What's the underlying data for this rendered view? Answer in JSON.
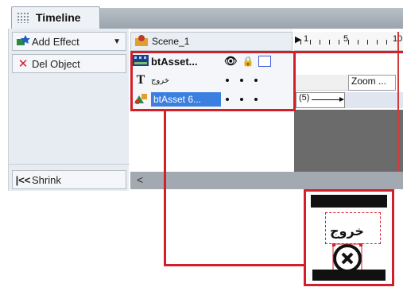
{
  "window": {
    "tab_title": "Timeline"
  },
  "left_panel": {
    "add_effect_label": "Add Effect",
    "del_object_label": "Del Object",
    "shrink_label": "Shrink"
  },
  "layers": {
    "scene_label": "Scene_1",
    "asset_group_label": "btAsset...",
    "text_layer_label": "خروج",
    "selected_layer_label": "btAsset 6..."
  },
  "timeline": {
    "ruler_marks": [
      "1",
      "5",
      "10"
    ],
    "zoom_label": "Zoom ...",
    "frame_label": "(5)"
  },
  "inset": {
    "text": "خروج"
  },
  "colors": {
    "highlight": "#d21f2a",
    "selection": "#3b7fe0"
  }
}
